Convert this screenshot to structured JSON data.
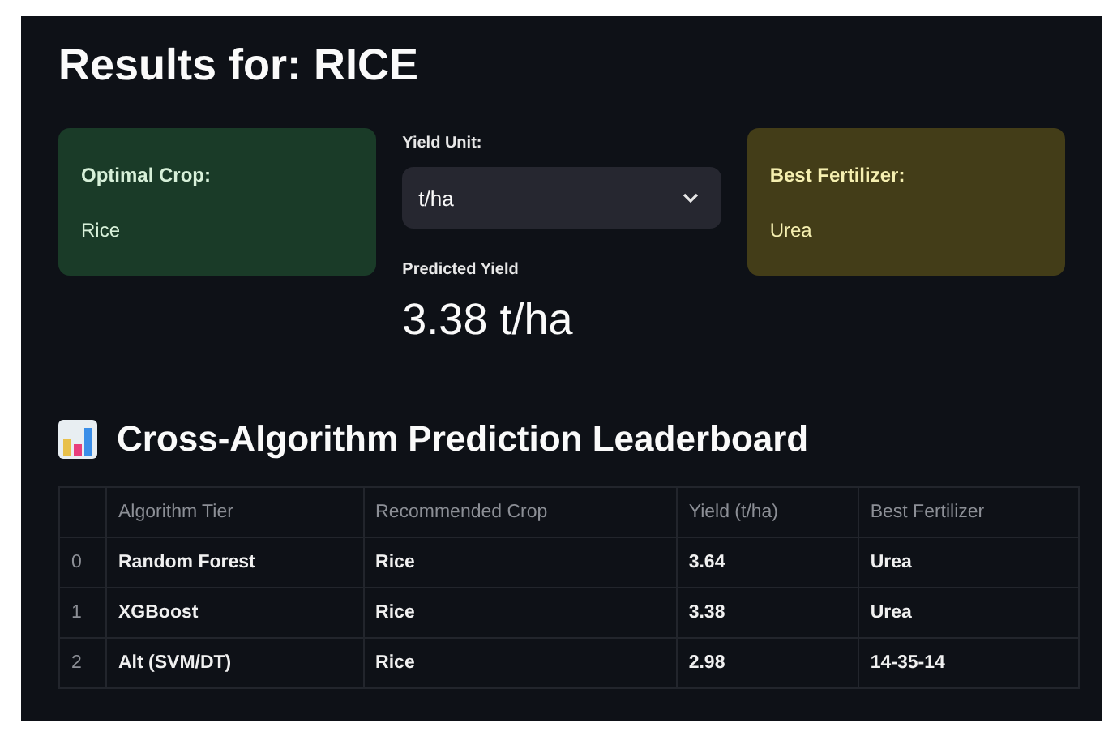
{
  "title": "Results for: RICE",
  "optimal_crop": {
    "label": "Optimal Crop:",
    "value": "Rice"
  },
  "yield_unit": {
    "label": "Yield Unit:",
    "value": "t/ha"
  },
  "predicted_yield": {
    "label": "Predicted Yield",
    "value": "3.38 t/ha"
  },
  "best_fertilizer": {
    "label": "Best Fertilizer:",
    "value": "Urea"
  },
  "leaderboard": {
    "title": "Cross-Algorithm Prediction Leaderboard",
    "columns": [
      "Algorithm Tier",
      "Recommended Crop",
      "Yield (t/ha)",
      "Best Fertilizer"
    ],
    "rows": [
      {
        "index": "0",
        "cells": [
          "Random Forest",
          "Rice",
          "3.64",
          "Urea"
        ]
      },
      {
        "index": "1",
        "cells": [
          "XGBoost",
          "Rice",
          "3.38",
          "Urea"
        ]
      },
      {
        "index": "2",
        "cells": [
          "Alt (SVM/DT)",
          "Rice",
          "2.98",
          "14-35-14"
        ]
      }
    ]
  }
}
